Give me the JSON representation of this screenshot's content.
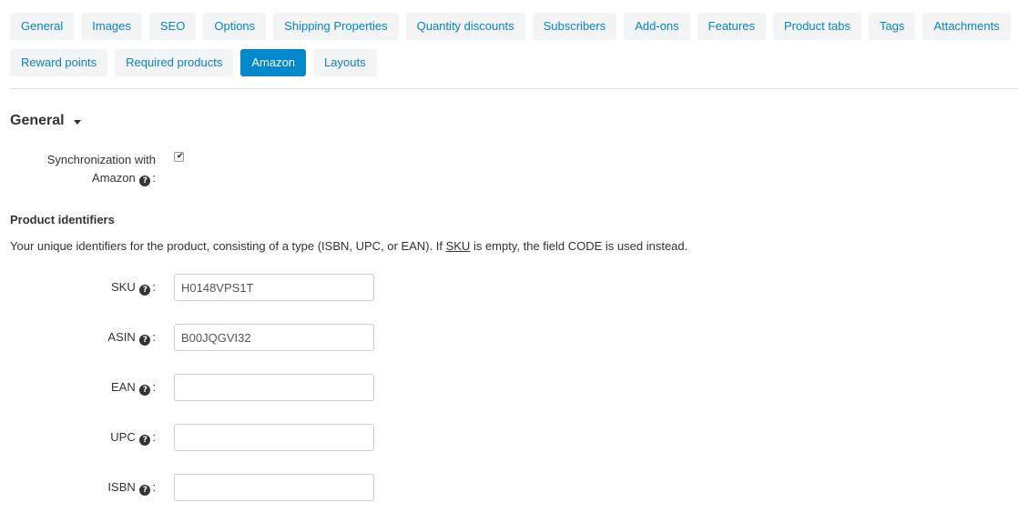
{
  "tabs": {
    "row1": [
      "General",
      "Images",
      "SEO",
      "Options",
      "Shipping Properties",
      "Quantity discounts",
      "Subscribers",
      "Add-ons",
      "Features",
      "Product tabs",
      "Tags",
      "Attachments"
    ],
    "row2": [
      "Reward points",
      "Required products",
      "Amazon",
      "Layouts"
    ],
    "active": "Amazon"
  },
  "section": {
    "title": "General"
  },
  "sync": {
    "label_line1": "Synchronization with",
    "label_line2": "Amazon",
    "checked": true
  },
  "identifiers": {
    "heading": "Product identifiers",
    "description_pre": "Your unique identifiers for the product, consisting of a type (ISBN, UPC, or EAN). If ",
    "description_sku": "SKU",
    "description_post": " is empty, the field CODE is used instead."
  },
  "fields": [
    {
      "label": "SKU",
      "value": "H0148VPS1T"
    },
    {
      "label": "ASIN",
      "value": "B00JQGVI32"
    },
    {
      "label": "EAN",
      "value": ""
    },
    {
      "label": "UPC",
      "value": ""
    },
    {
      "label": "ISBN",
      "value": ""
    }
  ],
  "help_glyph": "?",
  "colon": ":",
  "colors": {
    "accent": "#0388cc",
    "tab_bg": "#f2f4f5",
    "tab_text": "#0a84c4"
  }
}
